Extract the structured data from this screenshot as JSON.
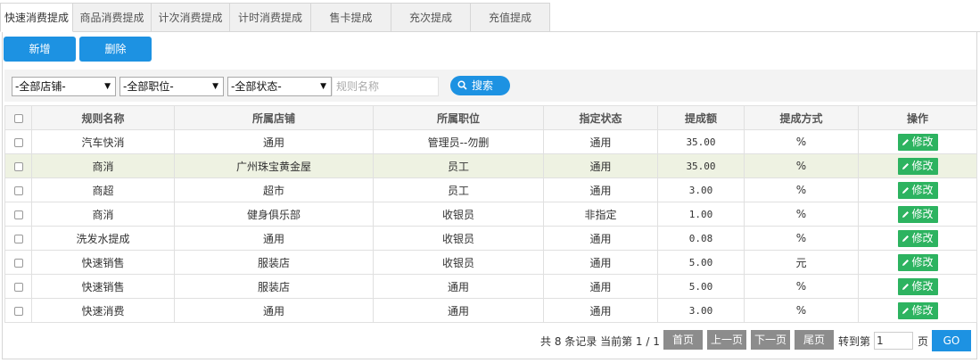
{
  "tabs": [
    {
      "label": "快速消费提成",
      "active": true
    },
    {
      "label": "商品消费提成"
    },
    {
      "label": "计次消费提成"
    },
    {
      "label": "计时消费提成"
    },
    {
      "label": "售卡提成"
    },
    {
      "label": "充次提成"
    },
    {
      "label": "充值提成"
    }
  ],
  "toolbar": {
    "add_label": "新增",
    "delete_label": "删除"
  },
  "filters": {
    "store": "-全部店铺-",
    "position": "-全部职位-",
    "status": "-全部状态-",
    "rule_name_placeholder": "规则名称",
    "search_label": "搜索"
  },
  "table": {
    "headers": [
      "规则名称",
      "所属店铺",
      "所属职位",
      "指定状态",
      "提成额",
      "提成方式",
      "操作"
    ],
    "edit_label": "修改",
    "rows": [
      {
        "name": "汽车快消",
        "store": "通用",
        "position": "管理员--勿删",
        "status": "通用",
        "amount": "35.00",
        "method": "%"
      },
      {
        "name": "商消",
        "store": "广州珠宝黄金屋",
        "position": "员工",
        "status": "通用",
        "amount": "35.00",
        "method": "%"
      },
      {
        "name": "商超",
        "store": "超市",
        "position": "员工",
        "status": "通用",
        "amount": "3.00",
        "method": "%"
      },
      {
        "name": "商消",
        "store": "健身俱乐部",
        "position": "收银员",
        "status": "非指定",
        "amount": "1.00",
        "method": "%"
      },
      {
        "name": "洗发水提成",
        "store": "通用",
        "position": "收银员",
        "status": "通用",
        "amount": "0.08",
        "method": "%"
      },
      {
        "name": "快速销售",
        "store": "服装店",
        "position": "收银员",
        "status": "通用",
        "amount": "5.00",
        "method": "元"
      },
      {
        "name": "快速销售",
        "store": "服装店",
        "position": "通用",
        "status": "通用",
        "amount": "5.00",
        "method": "%"
      },
      {
        "name": "快速消费",
        "store": "通用",
        "position": "通用",
        "status": "通用",
        "amount": "3.00",
        "method": "%"
      }
    ]
  },
  "pagination": {
    "summary": "共 8 条记录 当前第 1 / 1",
    "first": "首页",
    "prev": "上一页",
    "next": "下一页",
    "last": "尾页",
    "goto_label": "转到第",
    "goto_value": "1",
    "page_suffix": "页",
    "go_label": "GO"
  },
  "colors": {
    "accent": "#1d92e2",
    "edit": "#2db360",
    "highlight_row": "#eef2e2"
  }
}
